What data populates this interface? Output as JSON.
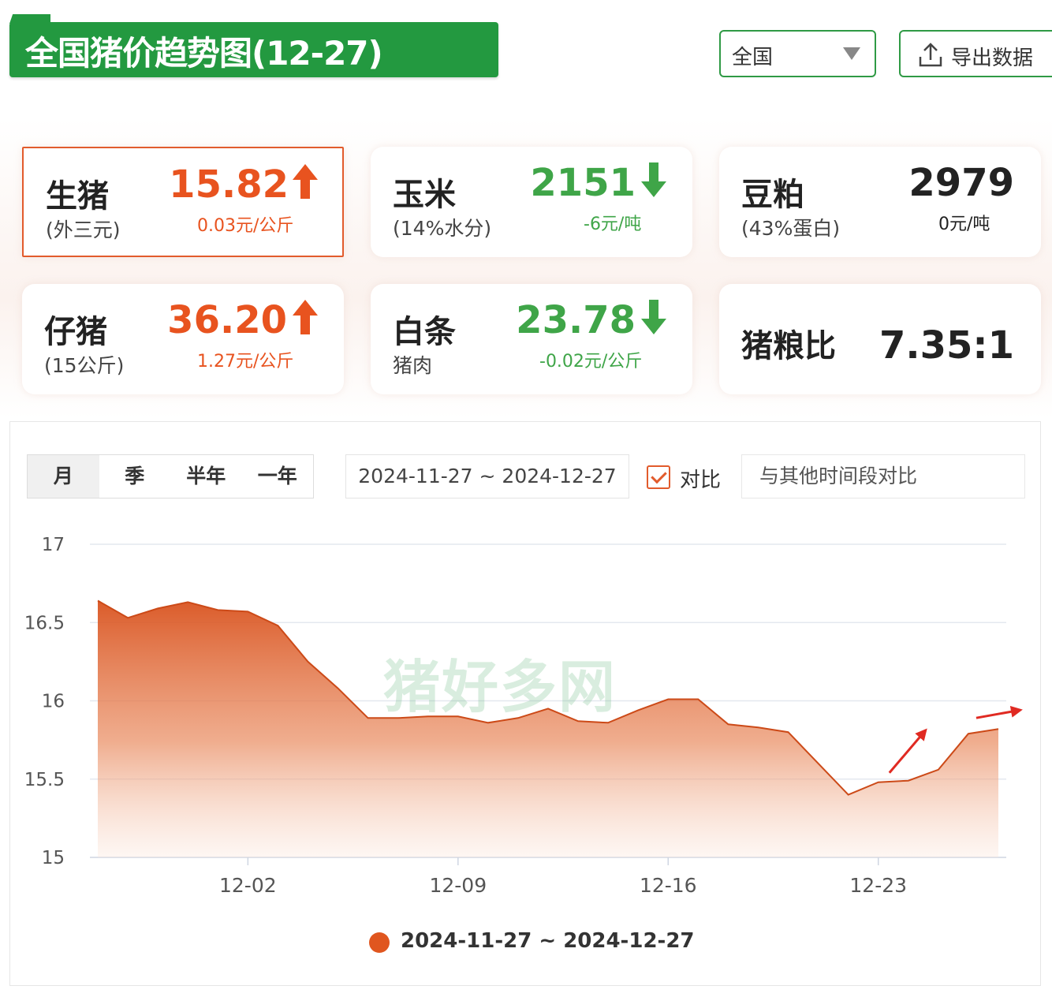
{
  "header": {
    "title": "全国猪价趋势图(12-27)",
    "region_select": "全国",
    "export_label": "导出数据"
  },
  "cards": [
    {
      "name": "生猪",
      "sub": "(外三元)",
      "value": "15.82",
      "delta": "0.03元/公斤",
      "trend": "up"
    },
    {
      "name": "玉米",
      "sub": "(14%水分)",
      "value": "2151",
      "delta": "-6元/吨",
      "trend": "down"
    },
    {
      "name": "豆粕",
      "sub": "(43%蛋白)",
      "value": "2979",
      "delta": "0元/吨",
      "trend": "flat"
    },
    {
      "name": "仔猪",
      "sub": "(15公斤)",
      "value": "36.20",
      "delta": "1.27元/公斤",
      "trend": "up"
    },
    {
      "name": "白条",
      "sub": "猪肉",
      "value": "23.78",
      "delta": "-0.02元/公斤",
      "trend": "down"
    },
    {
      "name": "猪粮比",
      "sub": "",
      "value": "7.35:1",
      "delta": "",
      "trend": "flat"
    }
  ],
  "controls": {
    "periods": [
      "月",
      "季",
      "半年",
      "一年"
    ],
    "active_period": "月",
    "date_range": "2024-11-27 ~ 2024-12-27",
    "compare_label": "对比",
    "compare_checked": true,
    "compare_placeholder": "与其他时间段对比"
  },
  "watermark": "猪好多网",
  "colors": {
    "brand_green": "#239940",
    "up": "#e8531f",
    "down": "#3fa548",
    "series": "#e0561f"
  },
  "chart_data": {
    "type": "area",
    "x": [
      "2024-11-27",
      "2024-11-28",
      "2024-11-29",
      "2024-11-30",
      "2024-12-01",
      "2024-12-02",
      "2024-12-03",
      "2024-12-04",
      "2024-12-05",
      "2024-12-06",
      "2024-12-07",
      "2024-12-08",
      "2024-12-09",
      "2024-12-10",
      "2024-12-11",
      "2024-12-12",
      "2024-12-13",
      "2024-12-14",
      "2024-12-15",
      "2024-12-16",
      "2024-12-17",
      "2024-12-18",
      "2024-12-19",
      "2024-12-20",
      "2024-12-21",
      "2024-12-22",
      "2024-12-23",
      "2024-12-24",
      "2024-12-25",
      "2024-12-26",
      "2024-12-27"
    ],
    "series": [
      {
        "name": "2024-11-27 ~ 2024-12-27",
        "values": [
          16.64,
          16.53,
          16.59,
          16.63,
          16.58,
          16.57,
          16.48,
          16.25,
          16.08,
          15.89,
          15.89,
          15.9,
          15.9,
          15.86,
          15.89,
          15.95,
          15.87,
          15.86,
          15.94,
          16.01,
          16.01,
          15.85,
          15.83,
          15.8,
          15.6,
          15.4,
          15.48,
          15.49,
          15.56,
          15.79,
          15.82
        ]
      }
    ],
    "xticks": [
      "12-02",
      "12-09",
      "12-16",
      "12-23"
    ],
    "yticks": [
      "15",
      "15.5",
      "16",
      "16.5",
      "17"
    ],
    "ylim": [
      15,
      17
    ],
    "grid": true,
    "legend_position": "bottom",
    "annotations": [
      "upward-red-arrows-at-end"
    ]
  }
}
